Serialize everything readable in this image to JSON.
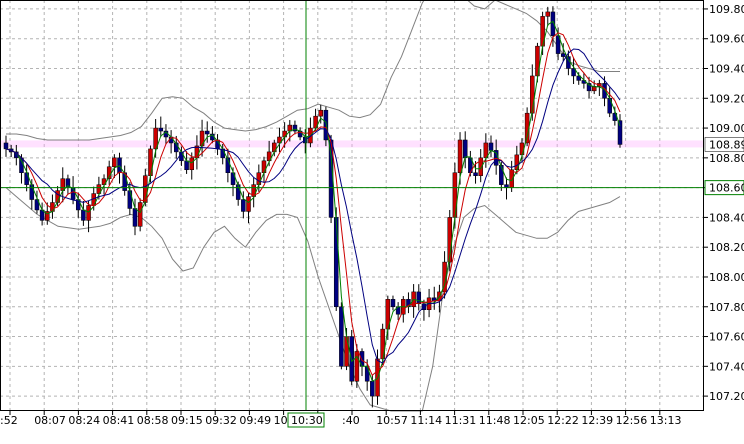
{
  "chart_data": {
    "type": "candlestick",
    "title": "",
    "xlabel": "",
    "ylabel": "",
    "grid": true,
    "ylim": [
      107.1,
      109.86
    ],
    "y_ticks": [
      "109.80",
      "109.60",
      "109.40",
      "109.20",
      "109.00",
      "108.80",
      "108.60",
      "108.40",
      "108.20",
      "108.00",
      "107.80",
      "107.60",
      "107.40",
      "107.20"
    ],
    "x_ticks": [
      ":52",
      "08:07",
      "08:24",
      "08:41",
      "08:58",
      "09:15",
      "09:32",
      "09:49",
      "10:06",
      "10:30",
      ":40",
      "10:57",
      "11:14",
      "11:31",
      "11:48",
      "12:05",
      "12:22",
      "12:39",
      "12:56",
      "13:13"
    ],
    "current_price_label": "108.89",
    "crosshair_price_label": "108.60",
    "crosshair_time_label": "10:30",
    "colors": {
      "up_candle": "#cc0000",
      "down_candle": "#000080",
      "ma_fast": "#008000",
      "ma_mid": "#cc0000",
      "ma_slow": "#000080",
      "bands": "#808080",
      "crosshair": "#008000",
      "current_price_band": "#ffaaff"
    },
    "close_series": [
      108.86,
      108.84,
      108.8,
      108.7,
      108.62,
      108.52,
      108.45,
      108.38,
      108.44,
      108.5,
      108.58,
      108.66,
      108.6,
      108.52,
      108.45,
      108.38,
      108.48,
      108.56,
      108.62,
      108.66,
      108.74,
      108.8,
      108.7,
      108.58,
      108.46,
      108.34,
      108.5,
      108.68,
      108.86,
      109.0,
      108.98,
      108.94,
      108.9,
      108.84,
      108.78,
      108.72,
      108.8,
      108.88,
      108.98,
      108.96,
      108.92,
      108.86,
      108.8,
      108.7,
      108.62,
      108.52,
      108.44,
      108.54,
      108.62,
      108.7,
      108.78,
      108.84,
      108.9,
      108.94,
      108.98,
      109.02,
      108.98,
      108.94,
      108.9,
      109.0,
      109.08,
      109.12,
      108.92,
      108.4,
      107.8,
      107.4,
      107.6,
      107.3,
      107.5,
      107.4,
      107.3,
      107.2,
      107.45,
      107.65,
      107.85,
      107.8,
      107.75,
      107.85,
      107.8,
      107.9,
      107.82,
      107.78,
      107.86,
      107.84,
      107.9,
      108.1,
      108.4,
      108.7,
      108.92,
      108.8,
      108.7,
      108.68,
      108.8,
      108.9,
      108.85,
      108.75,
      108.62,
      108.6,
      108.72,
      108.82,
      108.9,
      109.1,
      109.35,
      109.55,
      109.75,
      109.78,
      109.62,
      109.5,
      109.48,
      109.4,
      109.35,
      109.32,
      109.3,
      109.25,
      109.28,
      109.3,
      109.2,
      109.1,
      109.05,
      108.89
    ],
    "band_upper": [
      108.96,
      108.96,
      108.95,
      108.93,
      108.92,
      108.92,
      108.92,
      108.92,
      108.92,
      108.93,
      108.94,
      108.95,
      108.97,
      109.01,
      109.1,
      109.2,
      109.21,
      109.2,
      109.14,
      109.1,
      109.04,
      109.0,
      108.99,
      108.98,
      108.99,
      109.01,
      109.04,
      109.08,
      109.12,
      109.13,
      109.16,
      109.14,
      109.12,
      109.08,
      109.07,
      109.09,
      109.16,
      109.34,
      109.48,
      109.66,
      109.84,
      109.95,
      109.95,
      109.93,
      109.88,
      109.82,
      109.8,
      109.86,
      109.83,
      109.8,
      109.77,
      109.72,
      109.65,
      109.55,
      109.45,
      109.42,
      109.4,
      109.38,
      109.38,
      109.38
    ],
    "band_lower": [
      108.6,
      108.54,
      108.48,
      108.42,
      108.38,
      108.34,
      108.33,
      108.32,
      108.33,
      108.34,
      108.36,
      108.4,
      108.42,
      108.4,
      108.34,
      108.26,
      108.12,
      108.04,
      108.06,
      108.2,
      108.3,
      108.34,
      108.26,
      108.2,
      108.3,
      108.38,
      108.42,
      108.42,
      108.4,
      108.24,
      108.0,
      107.8,
      107.6,
      107.4,
      107.25,
      107.14,
      107.12,
      107.1,
      107.1,
      107.1,
      107.1,
      107.4,
      107.9,
      108.2,
      108.4,
      108.46,
      108.48,
      108.42,
      108.36,
      108.3,
      108.28,
      108.26,
      108.26,
      108.3,
      108.38,
      108.44,
      108.46,
      108.48,
      108.5,
      108.54
    ]
  }
}
